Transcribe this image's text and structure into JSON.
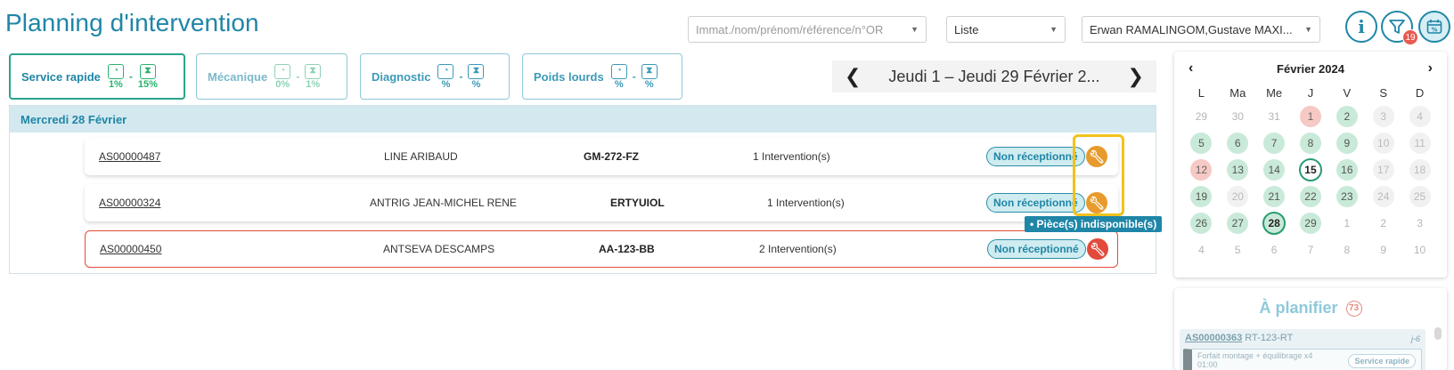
{
  "header": {
    "title": "Planning d'intervention",
    "search_placeholder": "Immat./nom/prénom/référence/n°OR",
    "view_value": "Liste",
    "technicians_value": "Erwan RAMALINGOM,Gustave MAXI...",
    "filter_count": "19"
  },
  "tabs": [
    {
      "label": "Service rapide",
      "pct1": "1%",
      "pct2": "15%"
    },
    {
      "label": "Mécanique",
      "pct1": "0%",
      "pct2": "1%"
    },
    {
      "label": "Diagnostic",
      "pct1": "%",
      "pct2": "%"
    },
    {
      "label": "Poids lourds",
      "pct1": "%",
      "pct2": "%"
    }
  ],
  "date_nav": {
    "range": "Jeudi 1 – Jeudi 29 Février 2..."
  },
  "day": {
    "label": "Mercredi 28 Février",
    "rows": [
      {
        "ref": "AS00000487",
        "name": "LINE ARIBAUD",
        "plate": "GM-272-FZ",
        "count": "1 Intervention(s)",
        "status": "Non réceptionné",
        "wrench": "orange"
      },
      {
        "ref": "AS00000324",
        "name": "ANTRIG JEAN-MICHEL RENE",
        "plate": "ERTYUIOL",
        "count": "1 Intervention(s)",
        "status": "Non réceptionné",
        "wrench": "orange"
      },
      {
        "ref": "AS00000450",
        "name": "ANTSEVA DESCAMPS",
        "plate": "AA-123-BB",
        "count": "2 Intervention(s)",
        "status": "Non réceptionné",
        "wrench": "red"
      }
    ],
    "tooltip": "• Pièce(s) indisponible(s)"
  },
  "calendar": {
    "month": "Février 2024",
    "prev": "‹",
    "next": "›",
    "dow": [
      "L",
      "Ma",
      "Me",
      "J",
      "V",
      "S",
      "D"
    ],
    "days": [
      {
        "d": "29",
        "s": "faded"
      },
      {
        "d": "30",
        "s": "faded"
      },
      {
        "d": "31",
        "s": "faded"
      },
      {
        "d": "1",
        "s": "red"
      },
      {
        "d": "2",
        "s": "green"
      },
      {
        "d": "3",
        "s": "grey"
      },
      {
        "d": "4",
        "s": "grey"
      },
      {
        "d": "5",
        "s": "green"
      },
      {
        "d": "6",
        "s": "green"
      },
      {
        "d": "7",
        "s": "green"
      },
      {
        "d": "8",
        "s": "green"
      },
      {
        "d": "9",
        "s": "green"
      },
      {
        "d": "10",
        "s": "grey"
      },
      {
        "d": "11",
        "s": "grey"
      },
      {
        "d": "12",
        "s": "red"
      },
      {
        "d": "13",
        "s": "green"
      },
      {
        "d": "14",
        "s": "green"
      },
      {
        "d": "15",
        "s": "today"
      },
      {
        "d": "16",
        "s": "green"
      },
      {
        "d": "17",
        "s": "grey"
      },
      {
        "d": "18",
        "s": "grey"
      },
      {
        "d": "19",
        "s": "green"
      },
      {
        "d": "20",
        "s": "grey"
      },
      {
        "d": "21",
        "s": "green"
      },
      {
        "d": "22",
        "s": "green"
      },
      {
        "d": "23",
        "s": "green"
      },
      {
        "d": "24",
        "s": "grey"
      },
      {
        "d": "25",
        "s": "grey"
      },
      {
        "d": "26",
        "s": "green"
      },
      {
        "d": "27",
        "s": "green"
      },
      {
        "d": "28",
        "s": "selected"
      },
      {
        "d": "29",
        "s": "green"
      },
      {
        "d": "1",
        "s": "faded"
      },
      {
        "d": "2",
        "s": "faded"
      },
      {
        "d": "3",
        "s": "faded"
      },
      {
        "d": "4",
        "s": "faded"
      },
      {
        "d": "5",
        "s": "faded"
      },
      {
        "d": "6",
        "s": "faded"
      },
      {
        "d": "7",
        "s": "faded"
      },
      {
        "d": "8",
        "s": "faded"
      },
      {
        "d": "9",
        "s": "faded"
      },
      {
        "d": "10",
        "s": "faded"
      }
    ]
  },
  "planifier": {
    "title": "À planifier",
    "count": "73",
    "card": {
      "ref": "AS00000363",
      "plate": "RT-123-RT",
      "jday": "j-6",
      "line": "Forfait montage + équilibrage x4",
      "duration": "01:00",
      "tag": "Service rapide"
    }
  },
  "colors": {
    "accent": "#1f86a7",
    "status_bg": "#cfecf0",
    "wrench_orange": "#e89a2c",
    "wrench_red": "#e24a3b",
    "highlight": "#f1c21b"
  }
}
